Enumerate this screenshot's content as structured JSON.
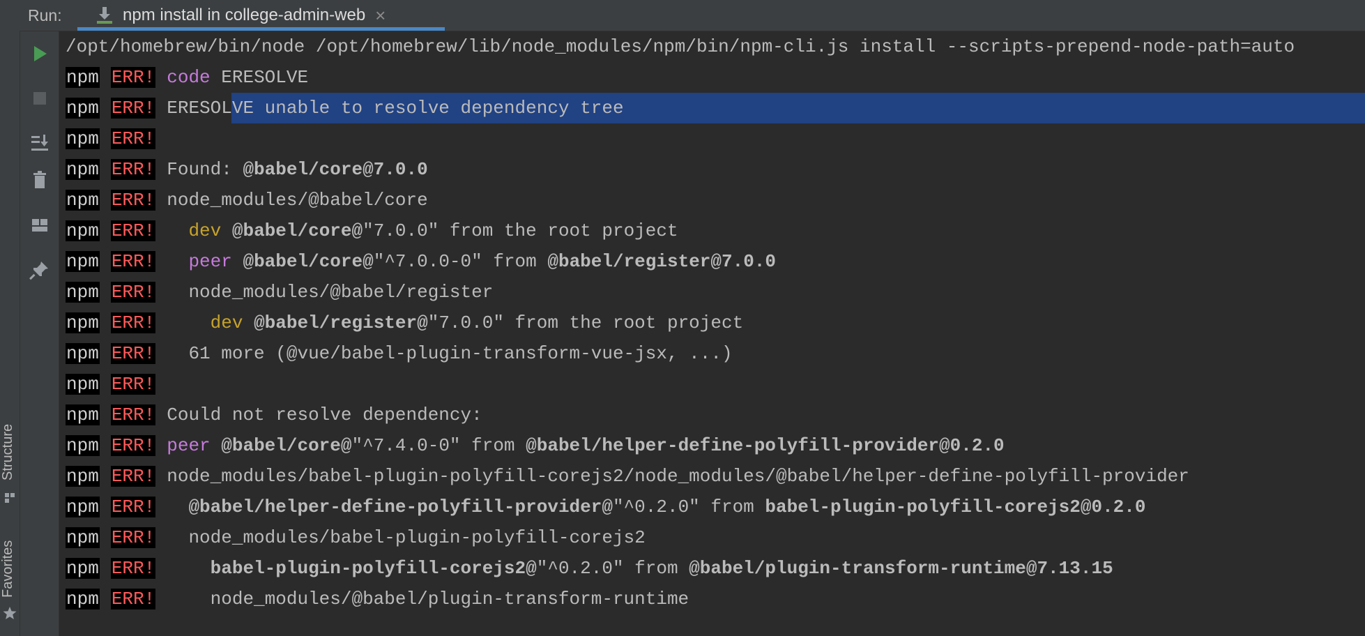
{
  "run": {
    "label": "Run:",
    "tab_title": "npm install in college-admin-web",
    "close_glyph": "×"
  },
  "side_stripe": {
    "structure": "Structure",
    "favorites": "Favorites"
  },
  "toolbar": [
    "play-icon",
    "stop-icon",
    "scroll-to-end-icon",
    "trash-icon",
    "layout-icon",
    "pin-icon"
  ],
  "colors": {
    "accent": "#4a88c7",
    "err": "#ff5a5a",
    "dev": "#c7a32b",
    "peer": "#c57bdb",
    "selection": "#214283"
  },
  "console": {
    "command": "/opt/homebrew/bin/node /opt/homebrew/lib/node_modules/npm/bin/npm-cli.js install --scripts-prepend-node-path=auto",
    "npm": "npm",
    "err": "ERR!",
    "l1": {
      "kw": "code",
      "rest": " ERESOLVE"
    },
    "l2": "ERESOLVE unable to resolve dependency tree",
    "l4": {
      "a": "Found: ",
      "b": "@babel/core@7.0.0"
    },
    "l5": "node_modules/@babel/core",
    "l6": {
      "indent": "  ",
      "kw": "dev",
      "b": " @babel/core@",
      "c": "\"7.0.0\" from the root project"
    },
    "l7": {
      "indent": "  ",
      "kw": "peer",
      "b": " @babel/core@",
      "c": "\"^7.0.0-0\" from ",
      "d": "@babel/register@7.0.0"
    },
    "l8": "  node_modules/@babel/register",
    "l9": {
      "indent": "    ",
      "kw": "dev",
      "b": " @babel/register@",
      "c": "\"7.0.0\" from the root project"
    },
    "l10": "  61 more (@vue/babel-plugin-transform-vue-jsx, ...)",
    "l12": "Could not resolve dependency:",
    "l13": {
      "kw": "peer",
      "b": " @babel/core@",
      "c": "\"^7.4.0-0\" from ",
      "d": "@babel/helper-define-polyfill-provider@0.2.0"
    },
    "l14": "node_modules/babel-plugin-polyfill-corejs2/node_modules/@babel/helper-define-polyfill-provider",
    "l15": {
      "indent": "  ",
      "b": "@babel/helper-define-polyfill-provider@",
      "c": "\"^0.2.0\" from ",
      "d": "babel-plugin-polyfill-corejs2@0.2.0"
    },
    "l16": "  node_modules/babel-plugin-polyfill-corejs2",
    "l17": {
      "indent": "    ",
      "b": "babel-plugin-polyfill-corejs2@",
      "c": "\"^0.2.0\" from ",
      "d": "@babel/plugin-transform-runtime@7.13.15"
    },
    "l18": "    node_modules/@babel/plugin-transform-runtime"
  }
}
